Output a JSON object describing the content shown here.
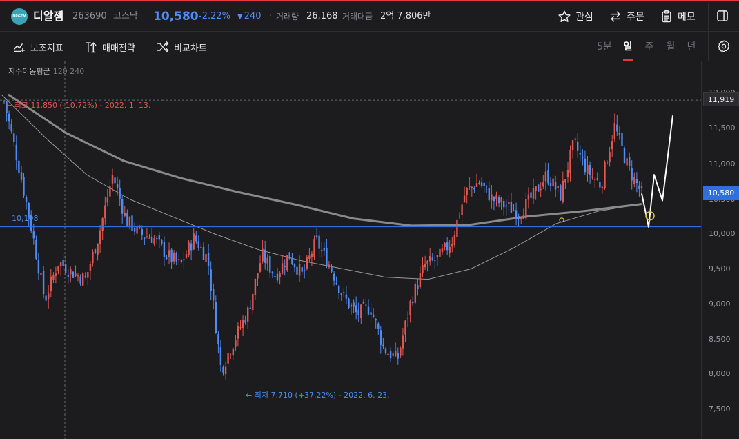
{
  "header": {
    "logo_text": "DRGEM",
    "stock_name": "디알젬",
    "stock_code": "263690",
    "market": "코스닥",
    "price": "10,580",
    "change_pct": "-2.22%",
    "change_abs": "240",
    "dot": "·",
    "volume_label": "거래량",
    "volume_value": "26,168",
    "amount_label": "거래대금",
    "amount_value": "2억 7,806만",
    "favorite_label": "관심",
    "order_label": "주문",
    "memo_label": "메모"
  },
  "toolbar": {
    "indicator_label": "보조지표",
    "strategy_label": "매매전략",
    "compare_label": "비교차트",
    "periods": [
      "5분",
      "일",
      "주",
      "월",
      "년"
    ],
    "active_period": "일"
  },
  "chart": {
    "ma_legend": "지수이동평균",
    "ma_periods": "120 240",
    "high_note": "← 최고 11,850 (-10.72%) - 2022. 1. 13.",
    "low_note": "← 최저 7,710 (+37.22%) - 2022. 6. 23.",
    "level_label": "10,108",
    "ref_price": "11,919",
    "current_price": "10,580",
    "y_ticks": [
      "12,000",
      "11,500",
      "11,000",
      "10,500",
      "10,000",
      "9,500",
      "9,000",
      "8,500",
      "8,000",
      "7,500"
    ],
    "colors": {
      "up": "#e25650",
      "down": "#4f8cf3",
      "level_line": "#2f6fdf",
      "ma_120": "#9a9a9a",
      "ma_240": "#8a8a8a",
      "forecast": "#ffffff",
      "marker": "#d9c24a"
    }
  },
  "chart_data": {
    "type": "candlestick",
    "y_range": [
      7400,
      12050
    ],
    "high": 11850,
    "low": 7710,
    "level": 10108,
    "current": 10580,
    "reference": 11919,
    "series": [
      {
        "name": "지수이동평균 120",
        "values": [
          12000,
          11400,
          10850,
          10500,
          10250,
          10000,
          9780,
          9620,
          9500,
          9380,
          9350,
          9500,
          9800,
          10150,
          10330,
          10430
        ]
      },
      {
        "name": "지수이동평균 240",
        "values": [
          12000,
          11450,
          11050,
          10800,
          10600,
          10420,
          10220,
          10120,
          10130,
          10250,
          10330,
          10430
        ]
      }
    ],
    "close_path": [
      11900,
      11050,
      10100,
      9050,
      9600,
      9450,
      9350,
      10000,
      10850,
      10200,
      10000,
      9950,
      9700,
      9550,
      9950,
      9650,
      8050,
      8500,
      8900,
      9700,
      9400,
      9700,
      9400,
      9900,
      9550,
      9100,
      8850,
      8950,
      8350,
      8200,
      9050,
      9550,
      9650,
      9900,
      10600,
      10750,
      10500,
      10400,
      10300,
      10550,
      10850,
      10550,
      11300,
      10900,
      10700,
      11550,
      10950,
      10580
    ],
    "forecast_path": [
      10580,
      10100,
      10850,
      10480,
      11700
    ]
  }
}
